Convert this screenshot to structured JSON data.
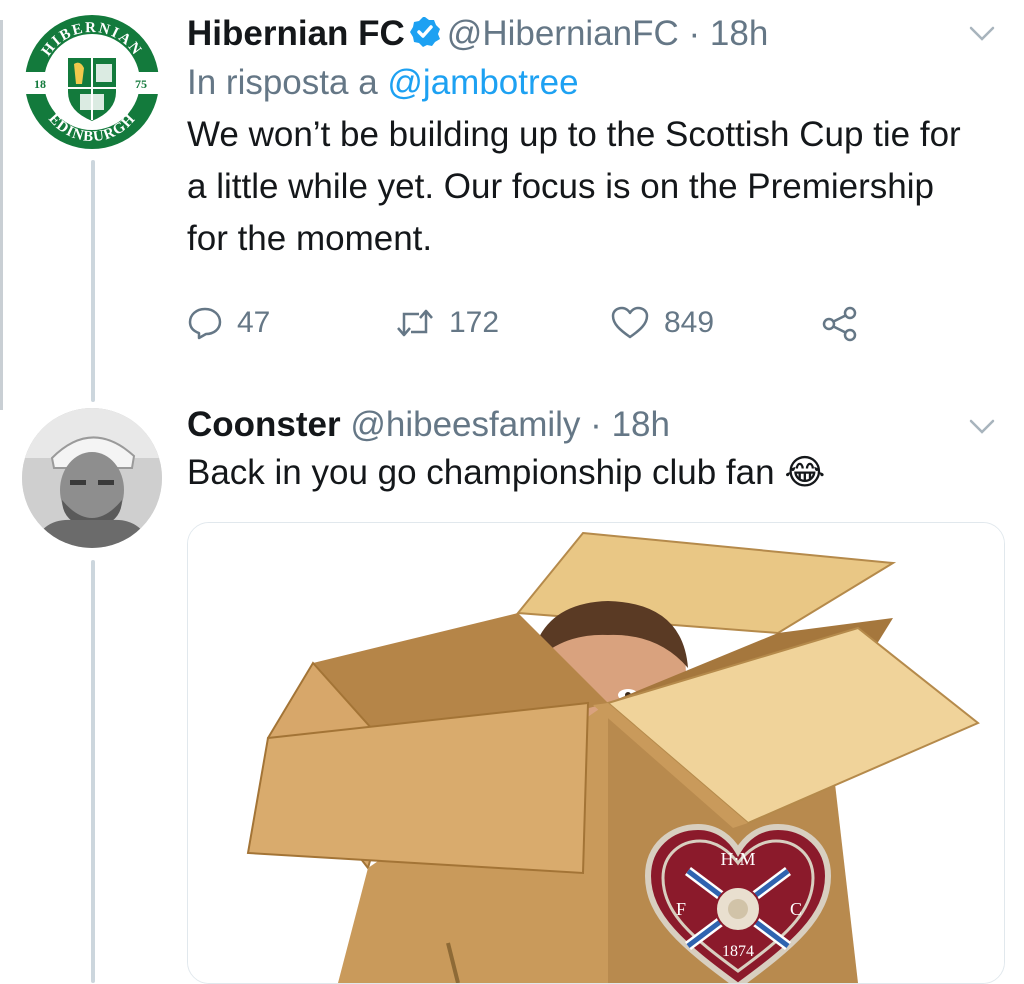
{
  "tweets": [
    {
      "name": "Hibernian FC",
      "handle": "@HibernianFC",
      "separator": "·",
      "time": "18h",
      "verified": true,
      "reply_prefix": "In risposta a",
      "reply_to": "@jambotree",
      "text": "We won’t be building up to the Scottish Cup tie for a little while yet. Our focus is on the Premiership for the moment.",
      "avatar": {
        "icon": "hibernian-crest-icon",
        "ring_top": "HIBERNIAN",
        "ring_bottom": "EDINBURGH",
        "year_left": "18",
        "year_right": "75",
        "color": "#137a3c"
      },
      "actions": {
        "replies": "47",
        "retweets": "172",
        "likes": "849"
      }
    },
    {
      "name": "Coonster",
      "handle": "@hibeesfamily",
      "separator": "·",
      "time": "18h",
      "verified": false,
      "text": "Back in you go championship club fan",
      "emoji": "😂",
      "avatar": {
        "icon": "user-photo-avatar"
      },
      "media": {
        "description_icon": "man-in-cardboard-box-image",
        "badge": {
          "top": "H·M",
          "left": "F",
          "right": "C",
          "bottom": "1874",
          "color": "#8b1a2b"
        }
      }
    }
  ],
  "colors": {
    "accent": "#1da1f2",
    "secondary_text": "#657786",
    "line": "#ccd6dd"
  }
}
